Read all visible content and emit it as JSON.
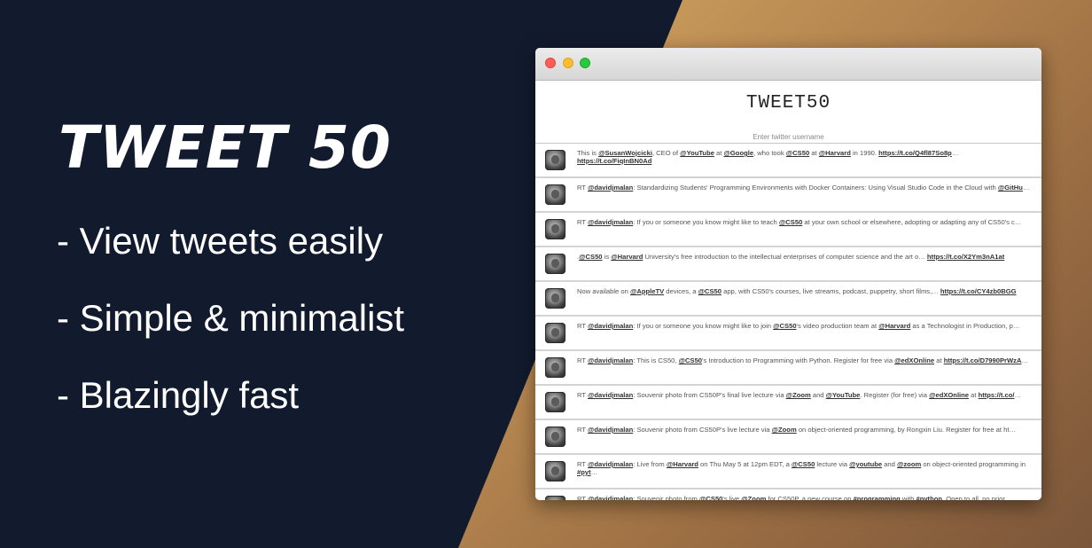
{
  "hero": {
    "title": "TWEET 50",
    "features": [
      "- View tweets easily",
      "- Simple & minimalist",
      "- Blazingly fast"
    ]
  },
  "window": {
    "app_title": "TWEET50",
    "search_placeholder": "Enter twitter username"
  },
  "tweets": [
    {
      "parts": [
        [
          "t",
          "This is "
        ],
        [
          "l",
          "@SusanWojcicki"
        ],
        [
          "t",
          ", CEO of "
        ],
        [
          "l",
          "@YouTube"
        ],
        [
          "t",
          " at "
        ],
        [
          "l",
          "@Google"
        ],
        [
          "t",
          ", who took "
        ],
        [
          "l",
          "@CS50"
        ],
        [
          "t",
          " at "
        ],
        [
          "l",
          "@Harvard"
        ],
        [
          "t",
          " in 1990. "
        ],
        [
          "l",
          "https://t.co/Q4fl87So8p"
        ],
        [
          "t",
          "… "
        ],
        [
          "l",
          "https://t.co/FiqInBN0Ad"
        ]
      ],
      "wrap": true
    },
    {
      "parts": [
        [
          "t",
          "RT "
        ],
        [
          "l",
          "@davidjmalan"
        ],
        [
          "t",
          ": Standardizing Students' Programming Environments with Docker Containers: Using Visual Studio Code in the Cloud with "
        ],
        [
          "l",
          "@GitHu"
        ],
        [
          "t",
          "…"
        ]
      ]
    },
    {
      "parts": [
        [
          "t",
          "RT "
        ],
        [
          "l",
          "@davidjmalan"
        ],
        [
          "t",
          ": If you or someone you know might like to teach "
        ],
        [
          "l",
          "@CS50"
        ],
        [
          "t",
          " at your own school or elsewhere, adopting or adapting any of CS50's c…"
        ]
      ]
    },
    {
      "parts": [
        [
          "t",
          "."
        ],
        [
          "l",
          "@CS50"
        ],
        [
          "t",
          " is "
        ],
        [
          "l",
          "@Harvard"
        ],
        [
          "t",
          " University's free introduction to the intellectual enterprises of computer science and the art o… "
        ],
        [
          "l",
          "https://t.co/X2Ym3nA1at"
        ]
      ]
    },
    {
      "parts": [
        [
          "t",
          "Now available on "
        ],
        [
          "l",
          "@AppleTV"
        ],
        [
          "t",
          " devices, a "
        ],
        [
          "l",
          "@CS50"
        ],
        [
          "t",
          " app, with CS50's courses, live streams, podcast, puppetry, short films,… "
        ],
        [
          "l",
          "https://t.co/CY4zb0BGG"
        ]
      ]
    },
    {
      "parts": [
        [
          "t",
          "RT "
        ],
        [
          "l",
          "@davidjmalan"
        ],
        [
          "t",
          ": If you or someone you know might like to join "
        ],
        [
          "l",
          "@CS50"
        ],
        [
          "t",
          "'s video production team at "
        ],
        [
          "l",
          "@Harvard"
        ],
        [
          "t",
          " as a Technologist in Production, p…"
        ]
      ]
    },
    {
      "parts": [
        [
          "t",
          "RT "
        ],
        [
          "l",
          "@davidjmalan"
        ],
        [
          "t",
          ": This is CS50, "
        ],
        [
          "l",
          "@CS50"
        ],
        [
          "t",
          "'s Introduction to Programming with Python. Register for free via "
        ],
        [
          "l",
          "@edXOnline"
        ],
        [
          "t",
          " at "
        ],
        [
          "l",
          "https://t.co/D7990PrWzA"
        ],
        [
          "t",
          "…"
        ]
      ]
    },
    {
      "parts": [
        [
          "t",
          "RT "
        ],
        [
          "l",
          "@davidjmalan"
        ],
        [
          "t",
          ": Souvenir photo from CS50P's final live lecture via "
        ],
        [
          "l",
          "@Zoom"
        ],
        [
          "t",
          " and "
        ],
        [
          "l",
          "@YouTube"
        ],
        [
          "t",
          ". Register (for free) via "
        ],
        [
          "l",
          "@edXOnline"
        ],
        [
          "t",
          " at "
        ],
        [
          "l",
          "https://t.co/"
        ],
        [
          "t",
          "…"
        ]
      ]
    },
    {
      "parts": [
        [
          "t",
          "RT "
        ],
        [
          "l",
          "@davidjmalan"
        ],
        [
          "t",
          ": Souvenir photo from CS50P's live lecture via "
        ],
        [
          "l",
          "@Zoom"
        ],
        [
          "t",
          " on object-oriented programming, by Rongxin Liu. Register for free at ht…"
        ]
      ]
    },
    {
      "parts": [
        [
          "t",
          "RT "
        ],
        [
          "l",
          "@davidjmalan"
        ],
        [
          "t",
          ": Live from "
        ],
        [
          "l",
          "@Harvard"
        ],
        [
          "t",
          " on Thu May 5 at 12pm EDT, a "
        ],
        [
          "l",
          "@CS50"
        ],
        [
          "t",
          " lecture via "
        ],
        [
          "l",
          "@youtube"
        ],
        [
          "t",
          " and "
        ],
        [
          "l",
          "@zoom"
        ],
        [
          "t",
          " on object-oriented programming in "
        ],
        [
          "l",
          "#pyt"
        ],
        [
          "t",
          "…"
        ]
      ],
      "wrap": true
    },
    {
      "parts": [
        [
          "t",
          "RT "
        ],
        [
          "l",
          "@davidjmalan"
        ],
        [
          "t",
          ": Souvenir photo from "
        ],
        [
          "l",
          "@CS50"
        ],
        [
          "t",
          "'s live "
        ],
        [
          "l",
          "@Zoom"
        ],
        [
          "t",
          " for CS50P, a new course on "
        ],
        [
          "l",
          "#programming"
        ],
        [
          "t",
          " with "
        ],
        [
          "l",
          "#python"
        ],
        [
          "t",
          ". Open to all, no prior…"
        ]
      ]
    }
  ],
  "colors": {
    "dark_panel": "#121a2e",
    "gold_panel": "#e2b870"
  },
  "icons": {
    "close": "traffic-light-red",
    "minimize": "traffic-light-yellow",
    "zoom": "traffic-light-green",
    "avatar": "cs50-avatar"
  }
}
